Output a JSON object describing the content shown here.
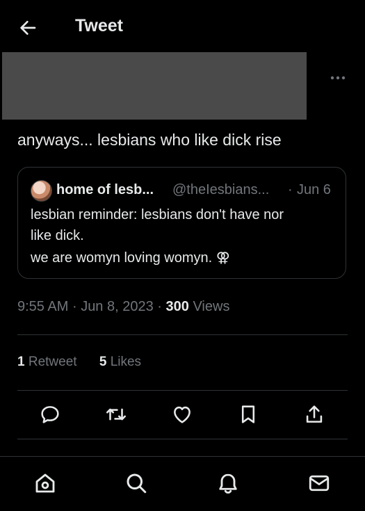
{
  "header": {
    "title": "Tweet",
    "back_icon": "arrow-left-icon"
  },
  "tweet": {
    "text": "anyways... lesbians who like dick rise",
    "more_icon": "more-horizontal-icon",
    "quote": {
      "name": "home of lesb...",
      "handle": "@theIesbians...",
      "separator": "·",
      "date": "Jun 6",
      "lines": [
        "lesbian reminder: lesbians don't have nor",
        "like dick.",
        "we are womyn loving womyn. ⚢"
      ]
    },
    "time": "9:55 AM",
    "dot": "·",
    "date": "Jun 8, 2023",
    "views_count": "300",
    "views_label": "Views"
  },
  "stats": {
    "retweets_count": "1",
    "retweets_label": "Retweet",
    "likes_count": "5",
    "likes_label": "Likes"
  },
  "actions": [
    "reply-icon",
    "retweet-icon",
    "like-icon",
    "bookmark-icon",
    "share-icon"
  ],
  "bottom_nav": [
    "home-icon",
    "search-icon",
    "notifications-icon",
    "messages-icon"
  ],
  "colors": {
    "background": "#000000",
    "text": "#e7e9ea",
    "secondary": "#71767b",
    "border": "#2f3336"
  }
}
